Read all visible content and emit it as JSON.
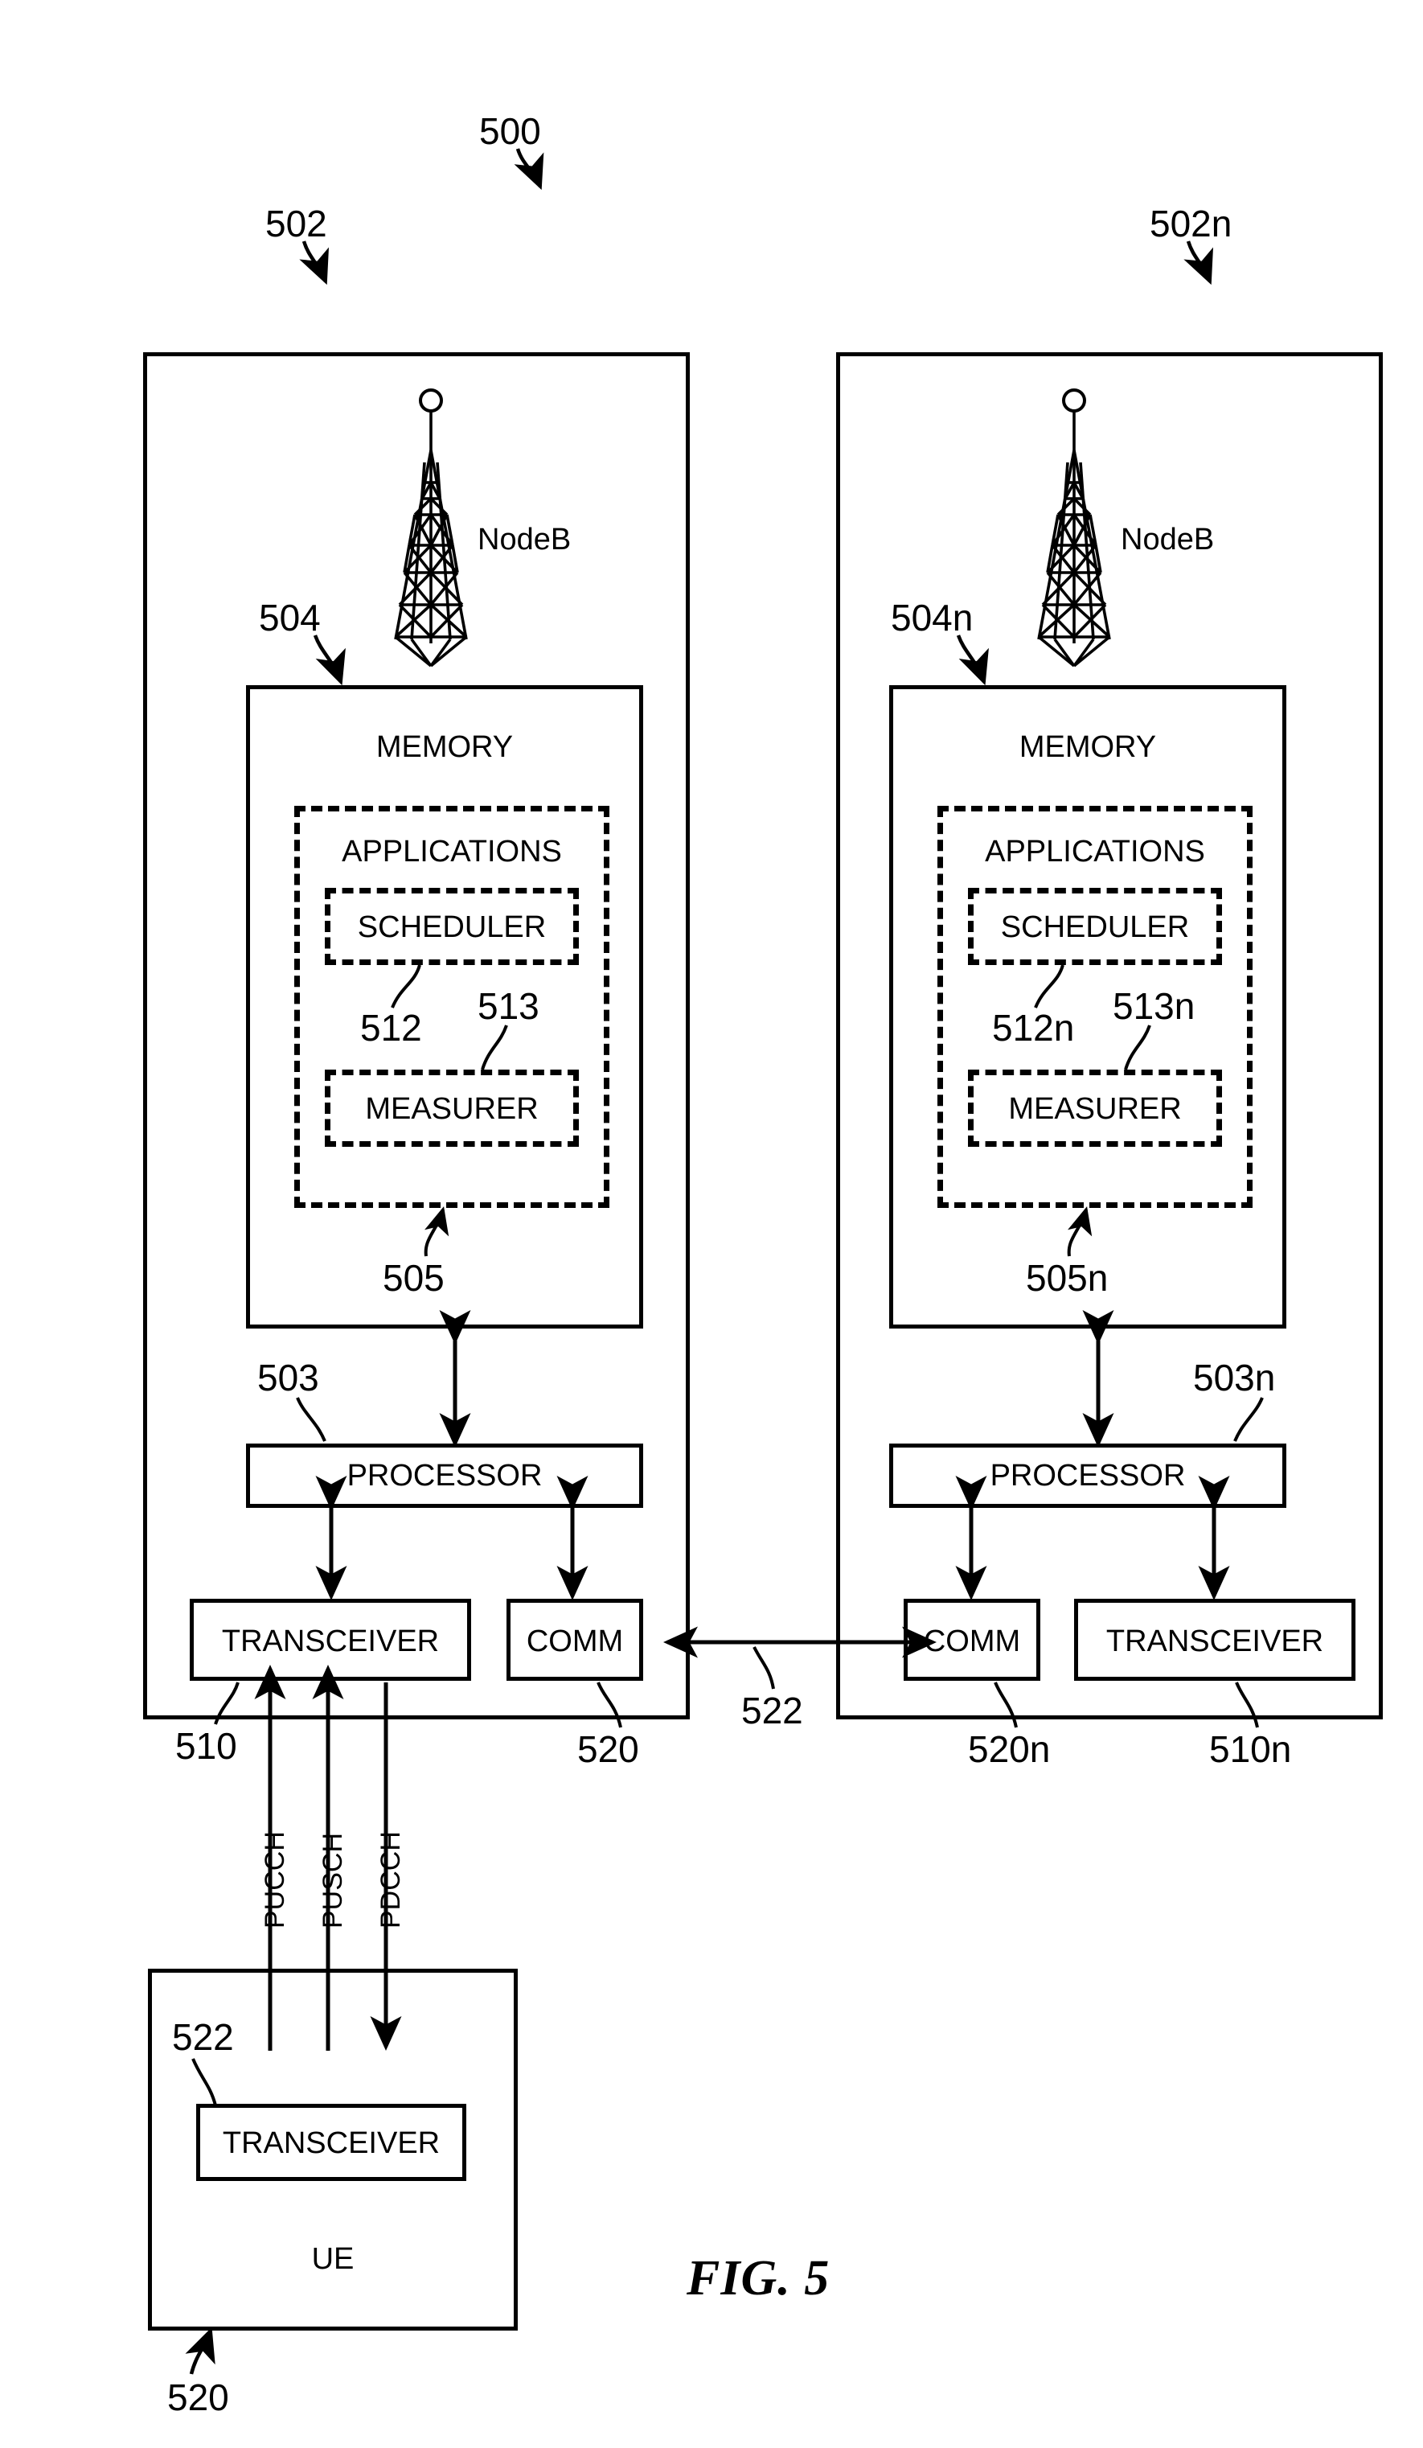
{
  "figure": {
    "caption": "FIG. 5",
    "system_ref": "500"
  },
  "nodes": [
    {
      "id": "left",
      "panel_ref": "502",
      "tower_label": "NodeB",
      "memory": {
        "title": "MEMORY",
        "ref": "504",
        "applications": {
          "title": "APPLICATIONS",
          "ref": "505",
          "modules": [
            {
              "title": "SCHEDULER",
              "ref": "512"
            },
            {
              "title": "MEASURER",
              "ref": "513"
            }
          ]
        }
      },
      "processor": {
        "title": "PROCESSOR",
        "ref": "503"
      },
      "transceiver": {
        "title": "TRANSCEIVER",
        "ref": "510"
      },
      "comm": {
        "title": "COMM",
        "ref": "520"
      }
    },
    {
      "id": "right",
      "panel_ref": "502n",
      "tower_label": "NodeB",
      "memory": {
        "title": "MEMORY",
        "ref": "504n",
        "applications": {
          "title": "APPLICATIONS",
          "ref": "505n",
          "modules": [
            {
              "title": "SCHEDULER",
              "ref": "512n"
            },
            {
              "title": "MEASURER",
              "ref": "513n"
            }
          ]
        }
      },
      "processor": {
        "title": "PROCESSOR",
        "ref": "503n"
      },
      "transceiver": {
        "title": "TRANSCEIVER",
        "ref": "510n"
      },
      "comm": {
        "title": "COMM",
        "ref": "520n"
      }
    }
  ],
  "interface": {
    "link_ref": "522"
  },
  "ue": {
    "title": "UE",
    "ref": "520",
    "transceiver": {
      "title": "TRANSCEIVER",
      "ref": "522"
    }
  },
  "channels": [
    {
      "name": "PUCCH"
    },
    {
      "name": "PUSCH"
    },
    {
      "name": "PDCCH"
    }
  ],
  "style": {
    "ink": "#000000",
    "paper": "#ffffff"
  }
}
